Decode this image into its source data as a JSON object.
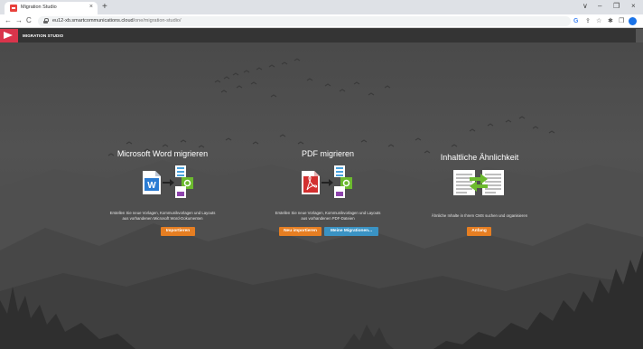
{
  "browser": {
    "tab_title": "Migration Studio",
    "tab_close": "×",
    "new_tab": "+",
    "url_host": "eu12-xb.smartcommunications.cloud",
    "url_path": "/one/migration-studio/",
    "nav": {
      "back": "←",
      "forward": "→",
      "reload": "C"
    },
    "window": {
      "chevron": "∨",
      "minimize": "–",
      "maximize": "❐",
      "close": "×"
    },
    "toolbar_icons": {
      "google": "G",
      "share": "⇪",
      "star": "☆",
      "extensions": "✱",
      "sidebar": "❒"
    }
  },
  "app": {
    "name": "MIGRATION STUDIO"
  },
  "cards": {
    "word": {
      "title": "Microsoft Word migrieren",
      "desc_line1": "Erstellen Sie neue Vorlagen, Kommunikvorlagen und Layouts",
      "desc_line2": "aus vorhandenen Microsoft Word-Dokumenten",
      "button": "Importieren",
      "icon_letter": "W"
    },
    "pdf": {
      "title": "PDF migrieren",
      "desc_line1": "Erstellen Sie neue Vorlagen, Kommunikvorlagen und Layouts",
      "desc_line2": "aus vorhandenen PDF-Dateien",
      "button_new": "Neu importieren",
      "button_mine": "Meine Migrationen..."
    },
    "similarity": {
      "title": "Inhaltliche Ähnlichkeit",
      "desc_line1": "Ähnliche Inhalte in Ihrem CMS suchen und organisieren",
      "button": "Anfang"
    }
  },
  "colors": {
    "accent_orange": "#e67e22",
    "accent_blue": "#3a93c4",
    "brand_red": "#d9344b",
    "header_bg": "#343434"
  }
}
